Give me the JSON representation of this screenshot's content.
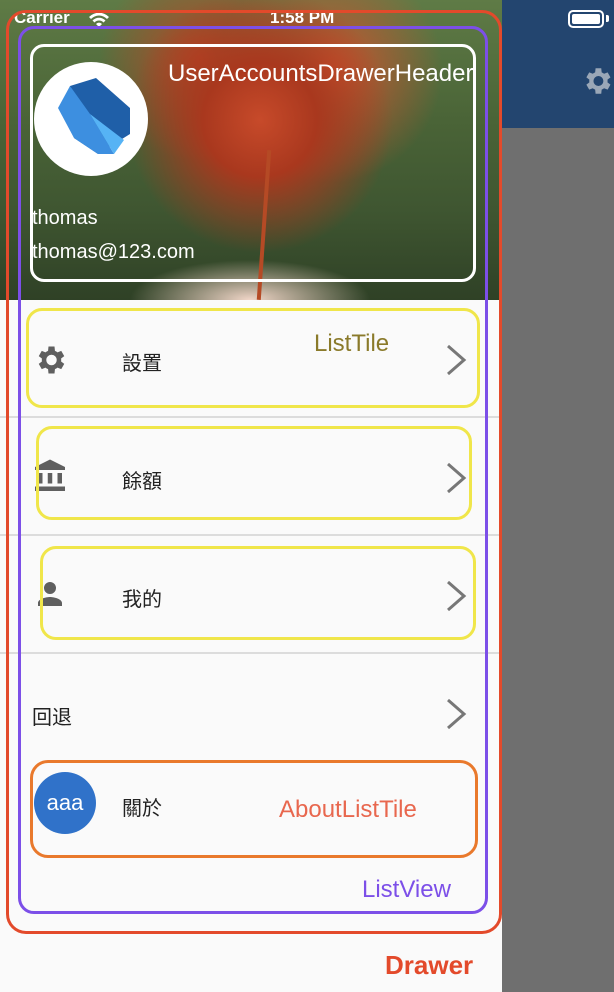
{
  "status_bar": {
    "carrier": "Carrier",
    "time": "1:58 PM"
  },
  "drawer_header": {
    "account_name": "thomas",
    "account_email": "thomas@123.com"
  },
  "menu": {
    "items": [
      {
        "icon": "gear-icon",
        "label": "設置"
      },
      {
        "icon": "bank-icon",
        "label": "餘額"
      },
      {
        "icon": "person-icon",
        "label": "我的"
      }
    ],
    "back_label": "回退",
    "about": {
      "avatar_text": "aaa",
      "label": "關於"
    }
  },
  "annotations": {
    "header": "UserAccountsDrawerHeader",
    "list_tile": "ListTile",
    "about_tile": "AboutListTile",
    "list_view": "ListView",
    "drawer": "Drawer"
  },
  "colors": {
    "drawer_box": "#e34a2b",
    "listview_box": "#7c4fe8",
    "header_box": "#ffffff",
    "listtile_box": "#f0e64a",
    "about_box": "#e9792c",
    "appbar": "#23456f",
    "about_avatar": "#3072c9"
  }
}
